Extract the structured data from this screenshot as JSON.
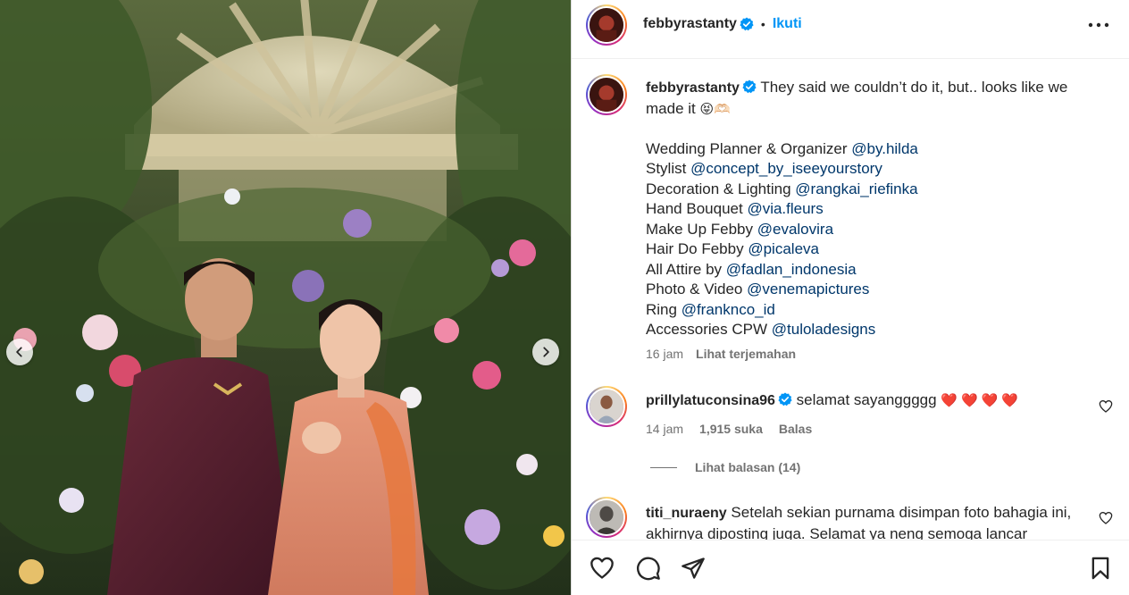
{
  "post": {
    "username": "febbyrastanty",
    "follow_label": "Ikuti",
    "dot": "•",
    "caption_first": "They said we couldn’t do it, but.. looks like we",
    "caption_second": "made it",
    "caption_emojis": "😝🫶🏻",
    "credits": [
      {
        "label": "Wedding Planner & Organizer",
        "handle": "@by.hilda"
      },
      {
        "label": "Stylist",
        "handle": "@concept_by_iseeyourstory"
      },
      {
        "label": "Decoration & Lighting",
        "handle": "@rangkai_riefinka"
      },
      {
        "label": "Hand Bouquet",
        "handle": "@via.fleurs"
      },
      {
        "label": "Make Up Febby",
        "handle": "@evalovira"
      },
      {
        "label": "Hair Do Febby",
        "handle": "@picaleva"
      },
      {
        "label": "All Attire by",
        "handle": "@fadlan_indonesia"
      },
      {
        "label": "Photo & Video",
        "handle": "@venemapictures"
      },
      {
        "label": "Ring",
        "handle": "@franknco_id"
      },
      {
        "label": "Accessories CPW",
        "handle": "@tuloladesigns"
      }
    ],
    "time": "16 jam",
    "translate_label": "Lihat terjemahan"
  },
  "comments": [
    {
      "username": "prillylatuconsina96",
      "text": "selamat sayanggggg",
      "hearts": "❤️❤️❤️❤️",
      "time": "14 jam",
      "likes": "1,915 suka",
      "reply": "Balas",
      "view_replies": "Lihat balasan (14)"
    },
    {
      "username": "titi_nuraeny",
      "text_line1": "Setelah sekian purnama disimpan foto bahagia ini,",
      "text_line2": "akhirnya diposting juga. Selamat ya neng semoga lancar"
    }
  ],
  "colors": {
    "link": "#00376b",
    "follow": "#0095f6",
    "muted": "#737373",
    "verified": "#0095f6"
  },
  "icons": [
    "chevron-left-icon",
    "chevron-right-icon",
    "verified-badge-icon",
    "more-options-icon",
    "heart-icon",
    "comment-icon",
    "share-icon",
    "bookmark-icon"
  ]
}
